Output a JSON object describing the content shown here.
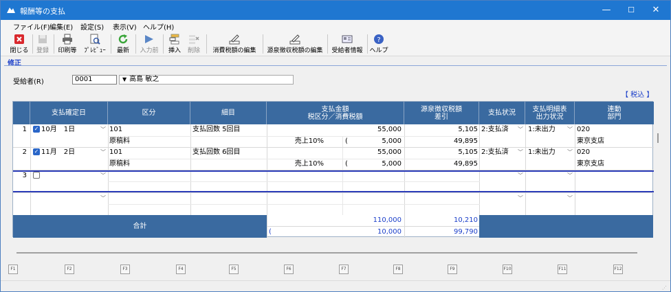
{
  "window": {
    "title": "報酬等の支払",
    "btn_min": "—",
    "btn_max": "☐",
    "btn_close": "✕"
  },
  "menu": [
    "ファイル(F)",
    "編集(E)",
    "設定(S)",
    "表示(V)",
    "ヘルプ(H)"
  ],
  "toolbar": [
    {
      "id": "close",
      "label": "閉じる",
      "icon": "close-icon",
      "enabled": true
    },
    {
      "id": "register",
      "label": "登録",
      "icon": "register-icon",
      "enabled": false
    },
    {
      "id": "print",
      "label": "印刷等",
      "icon": "printer-icon",
      "enabled": true
    },
    {
      "id": "preview",
      "label": "ﾌﾟﾚﾋﾞｭｰ",
      "icon": "preview-icon",
      "enabled": true
    },
    {
      "id": "refresh",
      "label": "最新",
      "icon": "refresh-icon",
      "enabled": true
    },
    {
      "id": "prev",
      "label": "入力前",
      "icon": "input-prev-icon",
      "enabled": false
    },
    {
      "id": "insert",
      "label": "挿入",
      "icon": "insert-row-icon",
      "enabled": true
    },
    {
      "id": "delete",
      "label": "削除",
      "icon": "delete-row-icon",
      "enabled": false
    },
    {
      "id": "ctax",
      "label": "消費税額の編集",
      "icon": "edit-consumption-tax-icon",
      "enabled": true
    },
    {
      "id": "wtax",
      "label": "源泉徴収税額の編集",
      "icon": "edit-withholding-icon",
      "enabled": true
    },
    {
      "id": "recipient",
      "label": "受給者情報",
      "icon": "recipient-info-icon",
      "enabled": true
    },
    {
      "id": "help",
      "label": "ヘルプ",
      "icon": "help-icon",
      "enabled": true
    }
  ],
  "mode": "修正",
  "recipient": {
    "label": "受給者(R)",
    "code": "0001",
    "name": "高島 敏之",
    "dropdown": "▼"
  },
  "tax_tag": "【 税込 】",
  "columns": {
    "date": "支払確定日",
    "kubun": "区分",
    "detail": "細目",
    "amount_l1": "支払金額",
    "amount_l2": "税区分／消費税額",
    "withhold_l1": "源泉徴収税額",
    "withhold_l2": "差引",
    "status": "支払状況",
    "stmt_l1": "支払明細表",
    "stmt_l2": "出力状況",
    "link_l1": "連動",
    "link_l2": "部門"
  },
  "rows": [
    {
      "no": "1",
      "checked": true,
      "date": "10月　1日",
      "kubun1": "101",
      "kubun2": "原稿料",
      "detail": "支払回数 5回目",
      "amount": "55,000",
      "taxclass": "売上10%",
      "paren": "(",
      "tax": "5,000",
      "withhold": "5,105",
      "net": "49,895",
      "status": "2:支払済",
      "stmt": "1:未出力",
      "link1": "020",
      "link2": "東京支店"
    },
    {
      "no": "2",
      "checked": true,
      "date": "11月　2日",
      "kubun1": "101",
      "kubun2": "原稿料",
      "detail": "支払回数 6回目",
      "amount": "55,000",
      "taxclass": "売上10%",
      "paren": "(",
      "tax": "5,000",
      "withhold": "5,105",
      "net": "49,895",
      "status": "2:支払済",
      "stmt": "1:未出力",
      "link1": "020",
      "link2": "東京支店"
    },
    {
      "no": "3",
      "checked": false,
      "date": "",
      "kubun1": "",
      "kubun2": "",
      "detail": "",
      "amount": "",
      "taxclass": "",
      "paren": "",
      "tax": "",
      "withhold": "",
      "net": "",
      "status": "",
      "stmt": "",
      "link1": "",
      "link2": ""
    }
  ],
  "total": {
    "label": "合計",
    "amount": "110,000",
    "paren": "(",
    "tax": "10,000",
    "withhold": "10,210",
    "net": "99,790"
  },
  "fkeys": [
    "F1",
    "F2",
    "F3",
    "F4",
    "F5",
    "F6",
    "F7",
    "F8",
    "F9",
    "F10",
    "F11",
    "F12"
  ],
  "colors": {
    "title": "#1f77d1",
    "header": "#3a6aa0",
    "accent": "#1a3ec9"
  }
}
